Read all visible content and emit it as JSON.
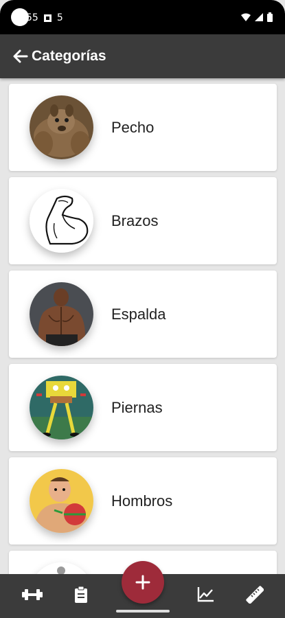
{
  "status_bar": {
    "time": "55",
    "extra": "5"
  },
  "app_bar": {
    "title": "Categorías",
    "back_icon": "arrow-left-icon"
  },
  "categories": [
    {
      "label": "Pecho"
    },
    {
      "label": "Brazos"
    },
    {
      "label": "Espalda"
    },
    {
      "label": "Piernas"
    },
    {
      "label": "Hombros"
    },
    {
      "label": ""
    }
  ],
  "bottom_nav": {
    "items": [
      "dumbbell-icon",
      "clipboard-icon",
      "add-icon",
      "chart-line-icon",
      "ruler-icon"
    ]
  },
  "colors": {
    "app_bar": "#3b3b3b",
    "fab": "#9e2b3a",
    "background": "#e6e6e6"
  }
}
